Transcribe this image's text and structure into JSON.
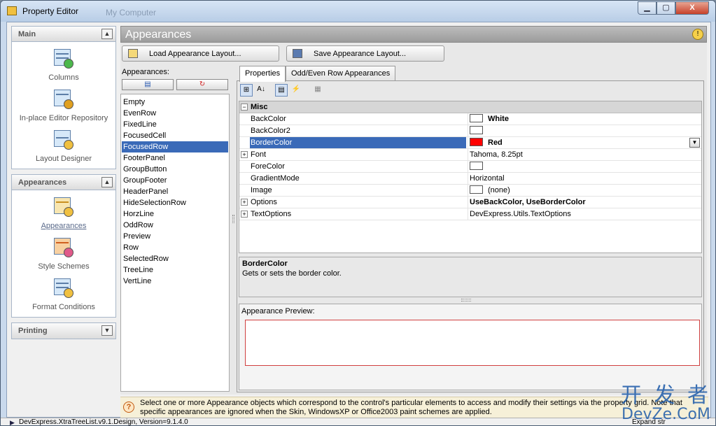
{
  "window": {
    "title": "Property Editor",
    "ghost_title": "My Computer",
    "min_label": "▁",
    "max_label": "▢",
    "close_label": "X"
  },
  "nav": {
    "groups": [
      {
        "label": "Main",
        "chevron": "▲",
        "items": [
          {
            "label": "Columns"
          },
          {
            "label": "In-place Editor Repository"
          },
          {
            "label": "Layout Designer"
          }
        ]
      },
      {
        "label": "Appearances",
        "chevron": "▲",
        "items": [
          {
            "label": "Appearances"
          },
          {
            "label": "Style Schemes"
          },
          {
            "label": "Format Conditions"
          }
        ]
      },
      {
        "label": "Printing",
        "chevron": "▼",
        "items": []
      }
    ]
  },
  "panel": {
    "title": "Appearances",
    "hint_icon": "lightbulb-icon"
  },
  "buttons": {
    "load": "Load Appearance Layout...",
    "save": "Save Appearance Layout..."
  },
  "appearances": {
    "label": "Appearances:",
    "items": [
      "Empty",
      "EvenRow",
      "FixedLine",
      "FocusedCell",
      "FocusedRow",
      "FooterPanel",
      "GroupButton",
      "GroupFooter",
      "HeaderPanel",
      "HideSelectionRow",
      "HorzLine",
      "OddRow",
      "Preview",
      "Row",
      "SelectedRow",
      "TreeLine",
      "VertLine"
    ],
    "selected": "FocusedRow"
  },
  "tabs": [
    {
      "label": "Properties",
      "active": true
    },
    {
      "label": "Odd/Even Row Appearances",
      "active": false
    }
  ],
  "grid": {
    "category": "Misc",
    "rows": [
      {
        "name": "BackColor",
        "value": "White",
        "swatch": "#ffffff",
        "bold": true,
        "expand": false
      },
      {
        "name": "BackColor2",
        "value": "",
        "swatch": "#ffffff",
        "bold": false,
        "expand": false
      },
      {
        "name": "BorderColor",
        "value": "Red",
        "swatch": "#ff0000",
        "bold": true,
        "expand": false,
        "selected": true
      },
      {
        "name": "Font",
        "value": "Tahoma, 8.25pt",
        "swatch": "",
        "bold": false,
        "expand": true
      },
      {
        "name": "ForeColor",
        "value": "",
        "swatch": "#ffffff",
        "bold": false,
        "expand": false
      },
      {
        "name": "GradientMode",
        "value": "Horizontal",
        "swatch": "",
        "bold": false,
        "expand": false
      },
      {
        "name": "Image",
        "value": "(none)",
        "swatch": "#ffffff",
        "bold": false,
        "expand": false
      },
      {
        "name": "Options",
        "value": "UseBackColor, UseBorderColor",
        "swatch": "",
        "bold": true,
        "expand": true
      },
      {
        "name": "TextOptions",
        "value": "DevExpress.Utils.TextOptions",
        "swatch": "",
        "bold": false,
        "expand": true
      }
    ]
  },
  "description": {
    "title": "BorderColor",
    "text": "Gets or sets the border color."
  },
  "preview": {
    "label": "Appearance Preview:"
  },
  "hint": {
    "text": "Select one or more Appearance objects which correspond to the control's particular elements to access and modify their settings via the property grid. Note that specific appearances are ignored when the Skin, WindowsXP or Office2003 paint schemes are applied."
  },
  "status": {
    "text": "DevExpress.XtraTreeList.v9.1.Design, Version=9.1.4.0",
    "right": "Expand str"
  },
  "watermark": {
    "cn": "开 发 者",
    "en": "DevZe.CoM"
  }
}
